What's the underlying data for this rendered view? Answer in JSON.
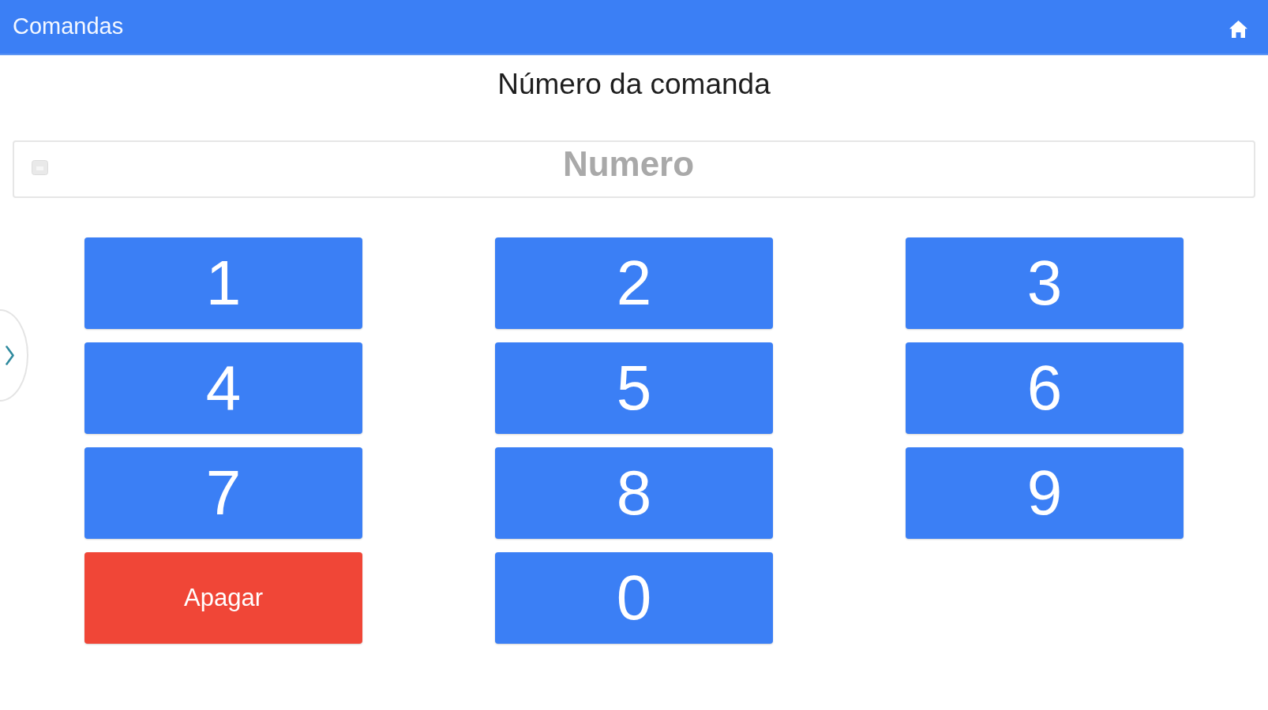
{
  "header": {
    "title": "Comandas"
  },
  "prompt": "Número da comanda",
  "number_field": {
    "placeholder": "Numero"
  },
  "keypad": [
    {
      "label": "1",
      "kind": "digit"
    },
    {
      "label": "2",
      "kind": "digit"
    },
    {
      "label": "3",
      "kind": "digit"
    },
    {
      "label": "4",
      "kind": "digit"
    },
    {
      "label": "5",
      "kind": "digit"
    },
    {
      "label": "6",
      "kind": "digit"
    },
    {
      "label": "7",
      "kind": "digit"
    },
    {
      "label": "8",
      "kind": "digit"
    },
    {
      "label": "9",
      "kind": "digit"
    },
    {
      "label": "Apagar",
      "kind": "delete"
    },
    {
      "label": "0",
      "kind": "digit"
    }
  ]
}
